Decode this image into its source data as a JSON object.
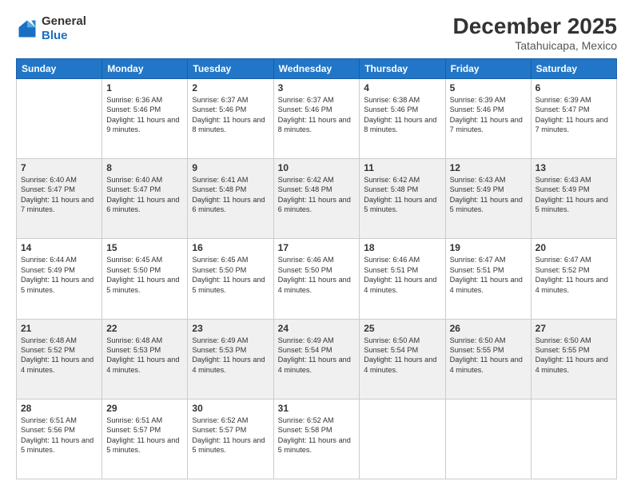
{
  "logo": {
    "general": "General",
    "blue": "Blue"
  },
  "header": {
    "month": "December 2025",
    "location": "Tatahuicapa, Mexico"
  },
  "weekdays": [
    "Sunday",
    "Monday",
    "Tuesday",
    "Wednesday",
    "Thursday",
    "Friday",
    "Saturday"
  ],
  "weeks": [
    [
      {
        "day": "",
        "sunrise": "",
        "sunset": "",
        "daylight": ""
      },
      {
        "day": "1",
        "sunrise": "Sunrise: 6:36 AM",
        "sunset": "Sunset: 5:46 PM",
        "daylight": "Daylight: 11 hours and 9 minutes."
      },
      {
        "day": "2",
        "sunrise": "Sunrise: 6:37 AM",
        "sunset": "Sunset: 5:46 PM",
        "daylight": "Daylight: 11 hours and 8 minutes."
      },
      {
        "day": "3",
        "sunrise": "Sunrise: 6:37 AM",
        "sunset": "Sunset: 5:46 PM",
        "daylight": "Daylight: 11 hours and 8 minutes."
      },
      {
        "day": "4",
        "sunrise": "Sunrise: 6:38 AM",
        "sunset": "Sunset: 5:46 PM",
        "daylight": "Daylight: 11 hours and 8 minutes."
      },
      {
        "day": "5",
        "sunrise": "Sunrise: 6:39 AM",
        "sunset": "Sunset: 5:46 PM",
        "daylight": "Daylight: 11 hours and 7 minutes."
      },
      {
        "day": "6",
        "sunrise": "Sunrise: 6:39 AM",
        "sunset": "Sunset: 5:47 PM",
        "daylight": "Daylight: 11 hours and 7 minutes."
      }
    ],
    [
      {
        "day": "7",
        "sunrise": "Sunrise: 6:40 AM",
        "sunset": "Sunset: 5:47 PM",
        "daylight": "Daylight: 11 hours and 7 minutes."
      },
      {
        "day": "8",
        "sunrise": "Sunrise: 6:40 AM",
        "sunset": "Sunset: 5:47 PM",
        "daylight": "Daylight: 11 hours and 6 minutes."
      },
      {
        "day": "9",
        "sunrise": "Sunrise: 6:41 AM",
        "sunset": "Sunset: 5:48 PM",
        "daylight": "Daylight: 11 hours and 6 minutes."
      },
      {
        "day": "10",
        "sunrise": "Sunrise: 6:42 AM",
        "sunset": "Sunset: 5:48 PM",
        "daylight": "Daylight: 11 hours and 6 minutes."
      },
      {
        "day": "11",
        "sunrise": "Sunrise: 6:42 AM",
        "sunset": "Sunset: 5:48 PM",
        "daylight": "Daylight: 11 hours and 5 minutes."
      },
      {
        "day": "12",
        "sunrise": "Sunrise: 6:43 AM",
        "sunset": "Sunset: 5:49 PM",
        "daylight": "Daylight: 11 hours and 5 minutes."
      },
      {
        "day": "13",
        "sunrise": "Sunrise: 6:43 AM",
        "sunset": "Sunset: 5:49 PM",
        "daylight": "Daylight: 11 hours and 5 minutes."
      }
    ],
    [
      {
        "day": "14",
        "sunrise": "Sunrise: 6:44 AM",
        "sunset": "Sunset: 5:49 PM",
        "daylight": "Daylight: 11 hours and 5 minutes."
      },
      {
        "day": "15",
        "sunrise": "Sunrise: 6:45 AM",
        "sunset": "Sunset: 5:50 PM",
        "daylight": "Daylight: 11 hours and 5 minutes."
      },
      {
        "day": "16",
        "sunrise": "Sunrise: 6:45 AM",
        "sunset": "Sunset: 5:50 PM",
        "daylight": "Daylight: 11 hours and 5 minutes."
      },
      {
        "day": "17",
        "sunrise": "Sunrise: 6:46 AM",
        "sunset": "Sunset: 5:50 PM",
        "daylight": "Daylight: 11 hours and 4 minutes."
      },
      {
        "day": "18",
        "sunrise": "Sunrise: 6:46 AM",
        "sunset": "Sunset: 5:51 PM",
        "daylight": "Daylight: 11 hours and 4 minutes."
      },
      {
        "day": "19",
        "sunrise": "Sunrise: 6:47 AM",
        "sunset": "Sunset: 5:51 PM",
        "daylight": "Daylight: 11 hours and 4 minutes."
      },
      {
        "day": "20",
        "sunrise": "Sunrise: 6:47 AM",
        "sunset": "Sunset: 5:52 PM",
        "daylight": "Daylight: 11 hours and 4 minutes."
      }
    ],
    [
      {
        "day": "21",
        "sunrise": "Sunrise: 6:48 AM",
        "sunset": "Sunset: 5:52 PM",
        "daylight": "Daylight: 11 hours and 4 minutes."
      },
      {
        "day": "22",
        "sunrise": "Sunrise: 6:48 AM",
        "sunset": "Sunset: 5:53 PM",
        "daylight": "Daylight: 11 hours and 4 minutes."
      },
      {
        "day": "23",
        "sunrise": "Sunrise: 6:49 AM",
        "sunset": "Sunset: 5:53 PM",
        "daylight": "Daylight: 11 hours and 4 minutes."
      },
      {
        "day": "24",
        "sunrise": "Sunrise: 6:49 AM",
        "sunset": "Sunset: 5:54 PM",
        "daylight": "Daylight: 11 hours and 4 minutes."
      },
      {
        "day": "25",
        "sunrise": "Sunrise: 6:50 AM",
        "sunset": "Sunset: 5:54 PM",
        "daylight": "Daylight: 11 hours and 4 minutes."
      },
      {
        "day": "26",
        "sunrise": "Sunrise: 6:50 AM",
        "sunset": "Sunset: 5:55 PM",
        "daylight": "Daylight: 11 hours and 4 minutes."
      },
      {
        "day": "27",
        "sunrise": "Sunrise: 6:50 AM",
        "sunset": "Sunset: 5:55 PM",
        "daylight": "Daylight: 11 hours and 4 minutes."
      }
    ],
    [
      {
        "day": "28",
        "sunrise": "Sunrise: 6:51 AM",
        "sunset": "Sunset: 5:56 PM",
        "daylight": "Daylight: 11 hours and 5 minutes."
      },
      {
        "day": "29",
        "sunrise": "Sunrise: 6:51 AM",
        "sunset": "Sunset: 5:57 PM",
        "daylight": "Daylight: 11 hours and 5 minutes."
      },
      {
        "day": "30",
        "sunrise": "Sunrise: 6:52 AM",
        "sunset": "Sunset: 5:57 PM",
        "daylight": "Daylight: 11 hours and 5 minutes."
      },
      {
        "day": "31",
        "sunrise": "Sunrise: 6:52 AM",
        "sunset": "Sunset: 5:58 PM",
        "daylight": "Daylight: 11 hours and 5 minutes."
      },
      {
        "day": "",
        "sunrise": "",
        "sunset": "",
        "daylight": ""
      },
      {
        "day": "",
        "sunrise": "",
        "sunset": "",
        "daylight": ""
      },
      {
        "day": "",
        "sunrise": "",
        "sunset": "",
        "daylight": ""
      }
    ]
  ]
}
